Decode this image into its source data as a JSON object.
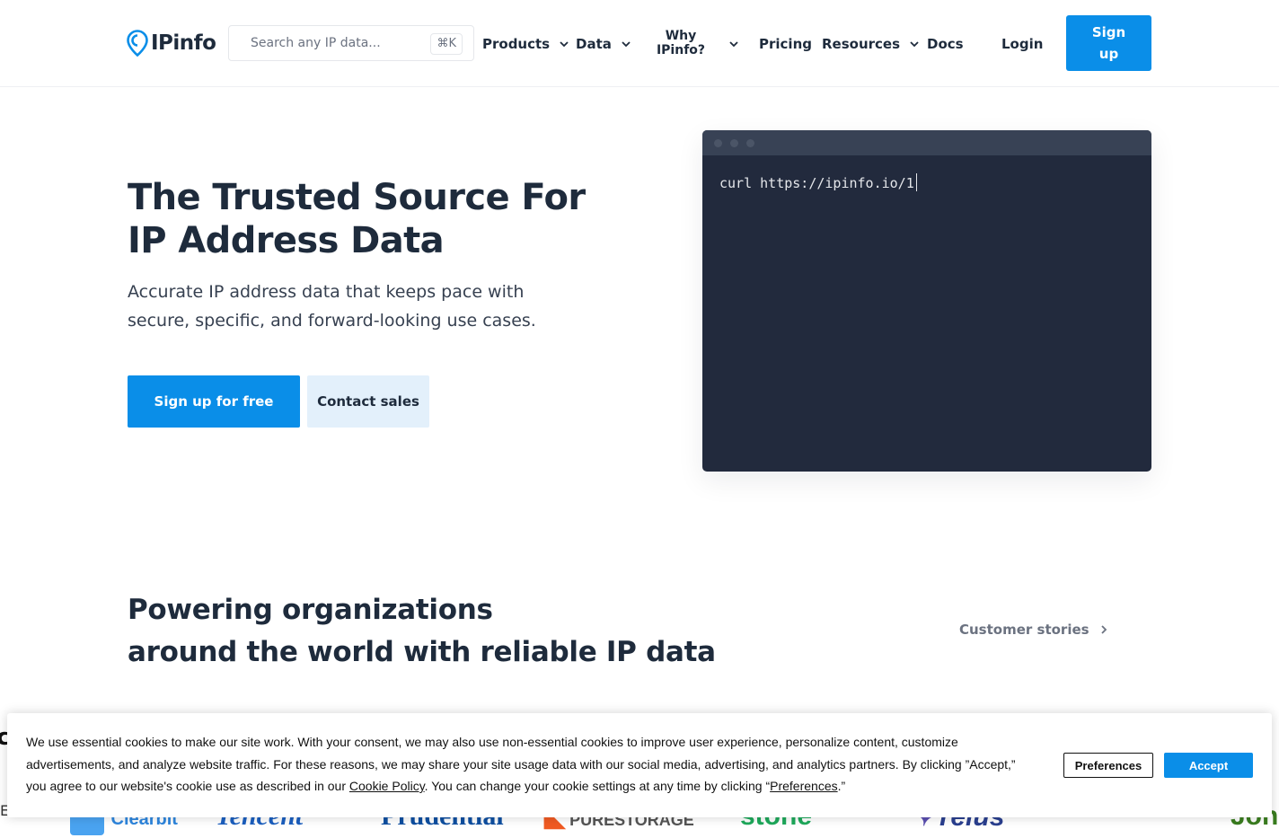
{
  "brand": {
    "name": "IPinfo",
    "accent": "#0a8ee8",
    "dark": "#1e2b3c"
  },
  "header": {
    "search_placeholder": "Search any IP data...",
    "search_shortcut": "⌘K",
    "nav": {
      "products": "Products",
      "data": "Data",
      "why_line1": "Why",
      "why_line2": "IPinfo?",
      "pricing": "Pricing",
      "resources": "Resources",
      "docs": "Docs",
      "login": "Login",
      "signup": "Sign up"
    }
  },
  "hero": {
    "title": "The Trusted Source For IP Address Data",
    "subtitle": "Accurate IP address data that keeps pace with secure, specific, and forward-looking use cases.",
    "primary_cta": "Sign up for free",
    "secondary_cta": "Contact sales"
  },
  "terminal": {
    "command": "curl https://ipinfo.io/1"
  },
  "organizations": {
    "title_line1": "Powering organizations",
    "title_line2": "around the world with reliable IP data",
    "stories_link": "Customer stories",
    "logos": [
      "Clearbit",
      "Tencent",
      "Prudential",
      "PURESTORAGE",
      "stone",
      "Telus",
      "",
      "John Deere"
    ]
  },
  "cookie_banner": {
    "text_part1": "We use essential cookies to make our site work. With your consent, we may also use non-essential cookies to improve user experience, personalize content, customize advertisements, and analyze website traffic. For these reasons, we may share your site usage data with our social media, advertising, and analytics partners. By clicking ”Accept,” you agree to our website's cookie use as described in our ",
    "cookie_policy_link": "Cookie Policy",
    "text_part2": ". You can change your cookie settings at any time by clicking “",
    "preferences_link": "Preferences",
    "text_part3": ".”",
    "preferences_button": "Preferences",
    "accept_button": "Accept"
  }
}
